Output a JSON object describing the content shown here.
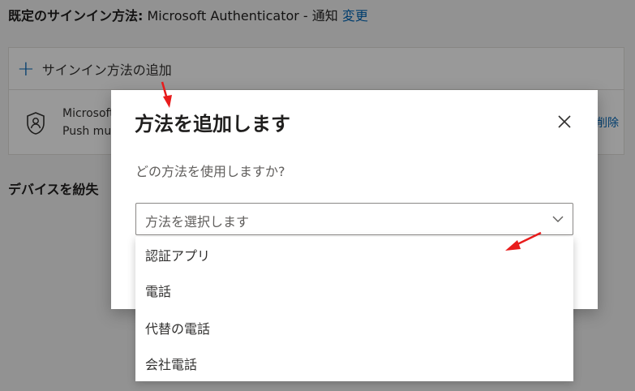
{
  "background": {
    "default_method_label": "既定のサインイン方法:",
    "default_method_value": " Microsoft Authenticator - 通知 ",
    "change_link": "変更",
    "add_method_label": "サインイン方法の追加",
    "method_name": "Microsoft",
    "method_detail": "Push mul",
    "delete_link": "削除",
    "lost_device_heading": "デバイスを紛失"
  },
  "dialog": {
    "title": "方法を追加します",
    "question": "どの方法を使用しますか?",
    "select_placeholder": "方法を選択します",
    "options": [
      {
        "label": "認証アプリ"
      },
      {
        "label": "電話"
      },
      {
        "label": "代替の電話"
      },
      {
        "label": "会社電話"
      }
    ]
  },
  "icons": {
    "add": "plus-icon",
    "authenticator": "authenticator-icon",
    "close": "close-icon",
    "chevron": "chevron-down-icon"
  },
  "colors": {
    "link": "#0067b8",
    "annotation_arrow": "#e81c1c",
    "overlay": "rgba(0,0,0,0.40)"
  }
}
